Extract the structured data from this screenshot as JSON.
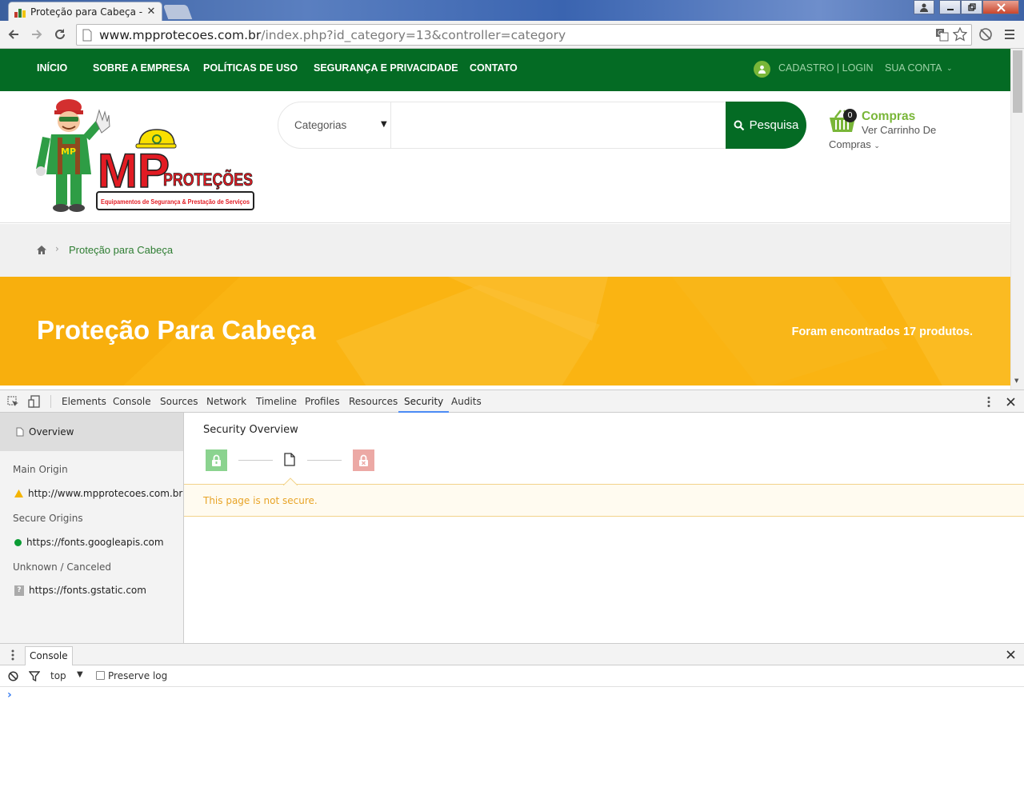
{
  "browser": {
    "tab_title": "Proteção para Cabeça - M",
    "close_glyph": "✕",
    "url_host": "www.mpprotecoes.com.br",
    "url_path": "/index.php?id_category=13&controller=category"
  },
  "site": {
    "nav": {
      "inicio": "INÍCIO",
      "sobre": "SOBRE A EMPRESA",
      "politicas": "POLÍTICAS DE USO",
      "seguranca": "SEGURANÇA E PRIVACIDADE",
      "contato": "CONTATO",
      "cadastro": "CADASTRO | LOGIN",
      "conta": "SUA CONTA"
    },
    "logo": {
      "big": "MP",
      "word": "PROTEÇÕES",
      "tagline": "Equipamentos de Segurança & Prestação de Serviços",
      "badge": "MP"
    },
    "search": {
      "category_label": "Categorias",
      "button_label": "Pesquisa"
    },
    "cart": {
      "count": "0",
      "title": "Compras",
      "line1": "Ver Carrinho De",
      "line2": "Compras"
    },
    "breadcrumb": {
      "current": "Proteção para Cabeça"
    },
    "banner": {
      "title": "Proteção Para Cabeça",
      "count_text": "Foram encontrados 17 produtos."
    },
    "colors": {
      "brand_green": "#046b24",
      "accent_green": "#79b638",
      "banner_yellow": "#fab412"
    }
  },
  "devtools": {
    "tabs": [
      "Elements",
      "Console",
      "Sources",
      "Network",
      "Timeline",
      "Profiles",
      "Resources",
      "Security",
      "Audits"
    ],
    "active_tab": "Security",
    "sidebar": {
      "overview": "Overview",
      "main_origin_heading": "Main Origin",
      "main_origin": "http://www.mpprotecoes.com.br",
      "secure_heading": "Secure Origins",
      "secure_origin": "https://fonts.googleapis.com",
      "unknown_heading": "Unknown / Canceled",
      "unknown_origin": "https://fonts.gstatic.com"
    },
    "security": {
      "heading": "Security Overview",
      "warning": "This page is not secure."
    },
    "drawer": {
      "tab": "Console",
      "context": "top",
      "preserve_log": "Preserve log",
      "prompt": "›"
    }
  }
}
